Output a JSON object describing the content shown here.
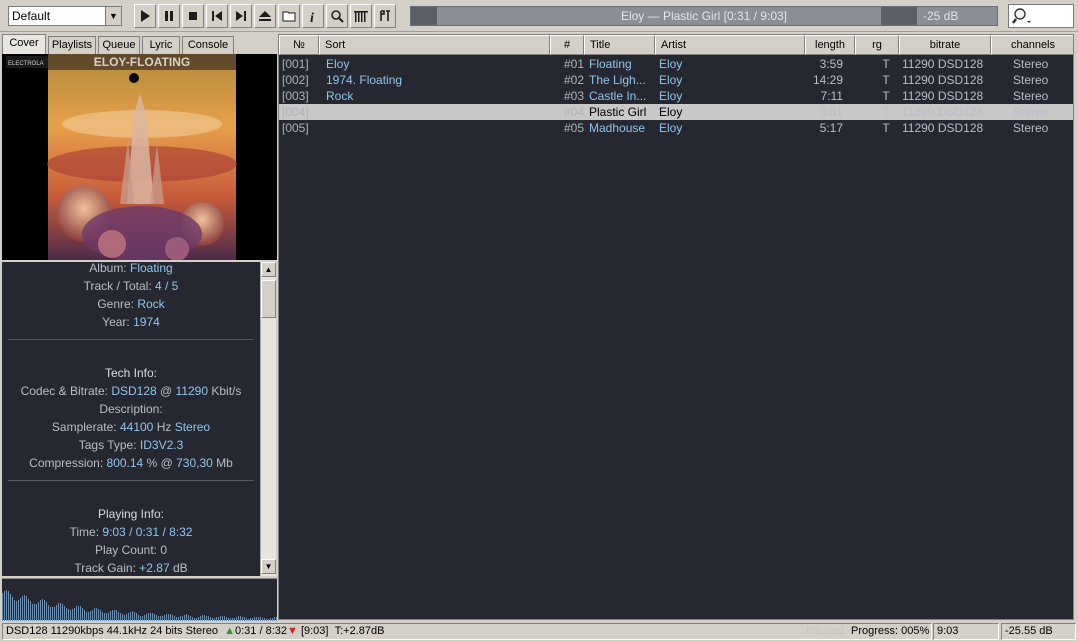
{
  "toolbar": {
    "preset": "Default",
    "buttons": [
      "play-icon",
      "pause-icon",
      "stop-icon",
      "prev-icon",
      "next-icon",
      "eject-icon",
      "folder-icon",
      "info-icon",
      "search-icon",
      "equalizer-icon",
      "settings-icon"
    ],
    "now_playing": "Eloy — Plastic Girl  [0:31 / 9:03]",
    "volume": "-25 dB",
    "seek_progress": 0.06
  },
  "tabs": [
    "Cover",
    "Playlists",
    "Queue",
    "Lyric",
    "Console"
  ],
  "cover": {
    "band": "ELOY-FLOATING",
    "label": "ELECTROLA"
  },
  "info": {
    "album_label": "Album:",
    "album": "Floating",
    "track_label": "Track / Total:",
    "track": "4 / 5",
    "genre_label": "Genre:",
    "genre": "Rock",
    "year_label": "Year:",
    "year": "1974",
    "tech_head": "Tech Info:",
    "codec_label": "Codec & Bitrate:",
    "codec": "DSD128",
    "codec_at": "@",
    "codec_rate": "11290",
    "codec_unit": "Kbit/s",
    "desc_label": "Description:",
    "srate_label": "Samplerate:",
    "srate": "44100",
    "srate_unit": "Hz",
    "srate_ch": "Stereo",
    "tags_label": "Tags Type:",
    "tags": "ID3V2.3",
    "comp_label": "Compression:",
    "comp": "800.14",
    "comp_mid": "% @",
    "comp_size": "730,30",
    "comp_unit": "Mb",
    "play_head": "Playing Info:",
    "time_label": "Time:",
    "time": "9:03 / 0:31 / 8:32",
    "count_label": "Play Count:",
    "count": "0",
    "gain_label": "Track Gain:",
    "gain": "+2.87",
    "gain_unit": "dB"
  },
  "playlist": {
    "columns": [
      "№",
      "Sort",
      "#",
      "Title",
      "Artist",
      "length",
      "rg",
      "bitrate",
      "channels"
    ],
    "rows": [
      {
        "no": "[001]",
        "sort": "Eloy",
        "trk": "#01",
        "title": "Floating",
        "artist": "Eloy",
        "length": "3:59",
        "rg": "T",
        "bitrate": "11290 DSD128",
        "channels": "Stereo"
      },
      {
        "no": "[002]",
        "sort": "1974. Floating",
        "trk": "#02",
        "title": "The Ligh...",
        "artist": "Eloy",
        "length": "14:29",
        "rg": "T",
        "bitrate": "11290 DSD128",
        "channels": "Stereo"
      },
      {
        "no": "[003]",
        "sort": "Rock",
        "trk": "#03",
        "title": "Castle In...",
        "artist": "Eloy",
        "length": "7:11",
        "rg": "T",
        "bitrate": "11290 DSD128",
        "channels": "Stereo"
      },
      {
        "no": "[004]",
        "sort": "",
        "trk": "#04",
        "title": "Plastic Girl",
        "artist": "Eloy",
        "length": "0:31",
        "rg": "T",
        "bitrate": "11290 DSD128",
        "channels": "Stereo"
      },
      {
        "no": "[005]",
        "sort": "",
        "trk": "#05",
        "title": "Madhouse",
        "artist": "Eloy",
        "length": "5:17",
        "rg": "T",
        "bitrate": "11290 DSD128",
        "channels": "Stereo"
      }
    ],
    "selected_row": 3
  },
  "status": {
    "format": "DSD128 11290kbps  44.1kHz 24 bits Stereo",
    "elapsed": "0:31 / 8:32",
    "total": "[9:03]",
    "gain": "T:+2.87dB",
    "paused": "Paused",
    "progress": "Progress: 005%",
    "time": "9:03",
    "volume": "-25.55 dB"
  },
  "colors": {
    "panel_bg": "#252830",
    "accent": "#8fc6ea",
    "chrome": "#d4d0c8"
  }
}
